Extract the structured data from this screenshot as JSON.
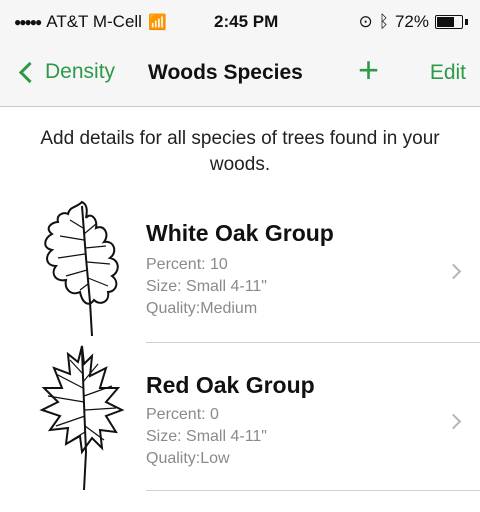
{
  "status": {
    "carrier": "AT&T M-Cell",
    "time": "2:45 PM",
    "battery_percent": "72%",
    "battery_level": 0.72
  },
  "nav": {
    "back_label": "Density",
    "title": "Woods Species",
    "add_symbol": "+",
    "edit_label": "Edit"
  },
  "intro_text": "Add details for all species of trees found in your woods.",
  "species": [
    {
      "name": "White Oak Group",
      "percent": "Percent: 10",
      "size": "Size: Small 4-11\"",
      "quality": "Quality:Medium"
    },
    {
      "name": "Red Oak Group",
      "percent": "Percent: 0",
      "size": "Size: Small 4-11\"",
      "quality": "Quality:Low"
    }
  ],
  "colors": {
    "accent": "#2e9a47",
    "secondary_text": "#8a8a8a"
  }
}
